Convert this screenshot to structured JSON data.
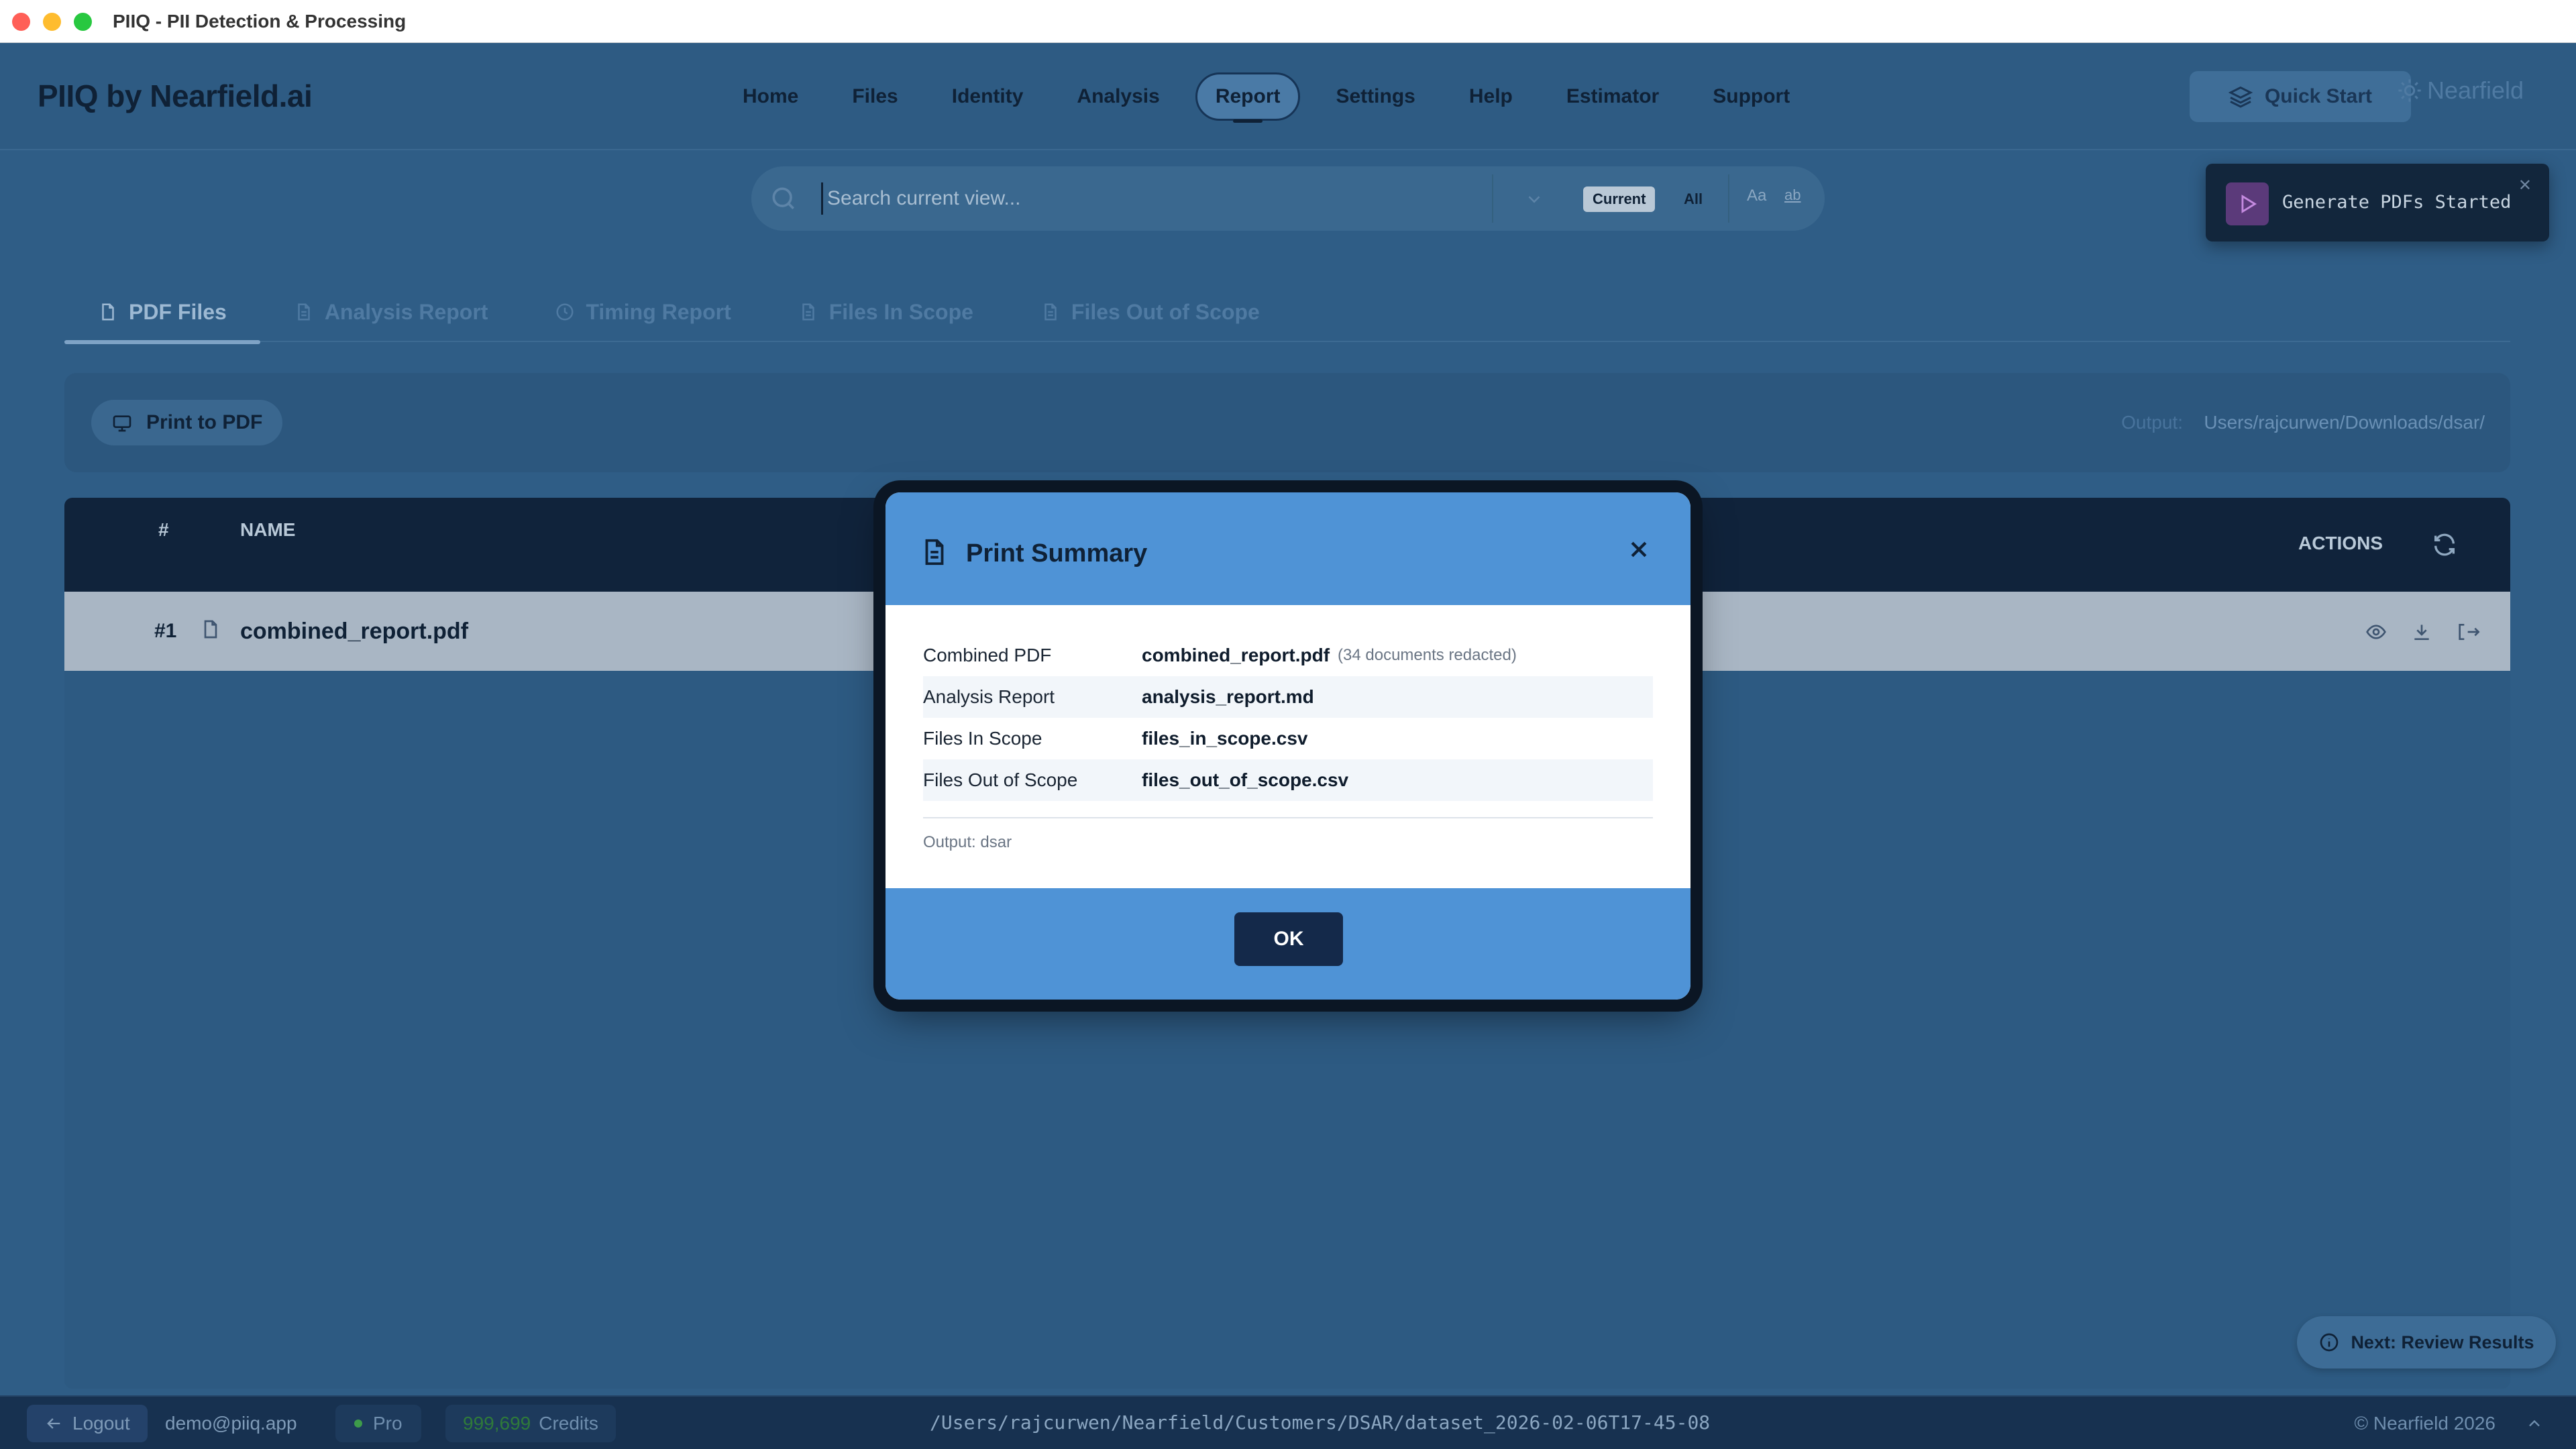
{
  "window": {
    "title": "PIIQ - PII Detection & Processing"
  },
  "header": {
    "brand": "PIIQ by Nearfield.ai",
    "nav": [
      "Home",
      "Files",
      "Identity",
      "Analysis",
      "Report",
      "Settings",
      "Help",
      "Estimator",
      "Support"
    ],
    "active_nav": "Report",
    "quick_start": "Quick Start",
    "logo_text": "Nearfield"
  },
  "search": {
    "placeholder": "Search current view...",
    "scope_current": "Current",
    "scope_all": "All",
    "match_case": "Aa",
    "whole_word": "ab"
  },
  "toast": {
    "text": "Generate PDFs Started"
  },
  "tabs": [
    "PDF Files",
    "Analysis Report",
    "Timing Report",
    "Files In Scope",
    "Files Out of Scope"
  ],
  "toolbar": {
    "print_label": "Print to PDF",
    "output_label": "Output:",
    "output_path": "Users/rajcurwen/Downloads/dsar/"
  },
  "table": {
    "headers": {
      "num": "#",
      "name": "NAME",
      "actions": "ACTIONS"
    },
    "rows": [
      {
        "num": "#1",
        "name": "combined_report.pdf"
      }
    ]
  },
  "modal": {
    "title": "Print Summary",
    "rows": [
      {
        "label": "Combined PDF",
        "value": "combined_report.pdf",
        "note": "(34 documents redacted)"
      },
      {
        "label": "Analysis Report",
        "value": "analysis_report.md",
        "note": ""
      },
      {
        "label": "Files In Scope",
        "value": "files_in_scope.csv",
        "note": ""
      },
      {
        "label": "Files Out of Scope",
        "value": "files_out_of_scope.csv",
        "note": ""
      }
    ],
    "output": "Output: dsar",
    "ok": "OK"
  },
  "next_button": "Next: Review Results",
  "status": {
    "logout": "Logout",
    "user": "demo@piiq.app",
    "plan": "Pro",
    "credits_value": "999,699",
    "credits_label": "Credits",
    "path": "/Users/rajcurwen/Nearfield/Customers/DSAR/dataset_2026-02-06T17-45-08",
    "copyright": "© Nearfield 2026"
  },
  "colors": {
    "accent": "#4f93d6",
    "background": "#2f5d86",
    "dark": "#10233b"
  }
}
